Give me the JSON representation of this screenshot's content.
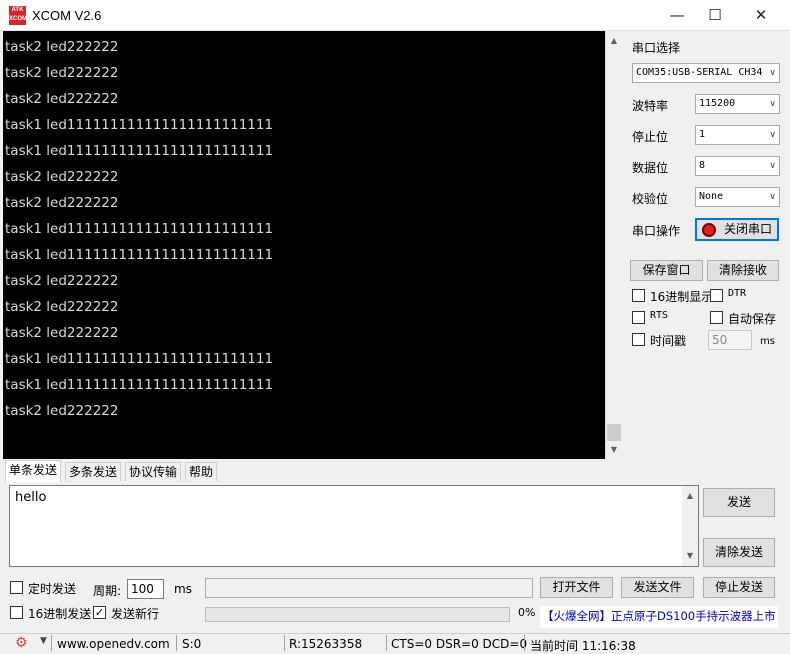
{
  "window": {
    "icon_text": "ATK XCOM",
    "title": "XCOM V2.6",
    "minimize": "—",
    "maximize": "☐",
    "close": "✕"
  },
  "terminal": {
    "lines": [
      "task2 led222222",
      "task2 led222222",
      "task2 led222222",
      "task1 led111111111111111111111111",
      "task1 led111111111111111111111111",
      "task2 led222222",
      "task2 led222222",
      "task1 led111111111111111111111111",
      "task1 led111111111111111111111111",
      "task2 led222222",
      "task2 led222222",
      "task2 led222222",
      "task1 led111111111111111111111111",
      "task1 led111111111111111111111111",
      "task2 led222222"
    ]
  },
  "settings": {
    "port_label": "串口选择",
    "port_value": "COM35:USB-SERIAL CH34",
    "baud_label": "波特率",
    "baud_value": "115200",
    "stop_label": "停止位",
    "stop_value": "1",
    "data_label": "数据位",
    "data_value": "8",
    "parity_label": "校验位",
    "parity_value": "None",
    "op_label": "串口操作",
    "close_port": "关闭串口",
    "save_window": "保存窗口",
    "clear_receive": "清除接收",
    "hex_display": "16进制显示",
    "dtr": "DTR",
    "rts": "RTS",
    "auto_save": "自动保存",
    "timestamp": "时间戳",
    "timestamp_value": "50",
    "ms": "ms"
  },
  "tabs": [
    "单条发送",
    "多条发送",
    "协议传输",
    "帮助"
  ],
  "send": {
    "text": "hello",
    "send_button": "发送",
    "clear_send": "清除发送",
    "timed_send": "定时发送",
    "period_label": "周期:",
    "period_value": "100",
    "ms": "ms",
    "open_file": "打开文件",
    "send_file": "发送文件",
    "stop_send": "停止发送",
    "hex_send": "16进制发送",
    "send_newline": "发送新行",
    "progress_percent": "0%",
    "progress_value": 0,
    "ad_text": "【火爆全网】正点原子DS100手持示波器上市"
  },
  "statusbar": {
    "gear": "⚙",
    "website": "www.openedv.com",
    "sent": "S:0",
    "received": "R:15263358",
    "signals": "CTS=0 DSR=0 DCD=0",
    "time": "当前时间 11:16:38"
  },
  "colors": {
    "terminal_bg": "#000000",
    "terminal_fg": "#d9d9d9",
    "accent": "#0078d7",
    "ad_text": "#0000cc"
  }
}
